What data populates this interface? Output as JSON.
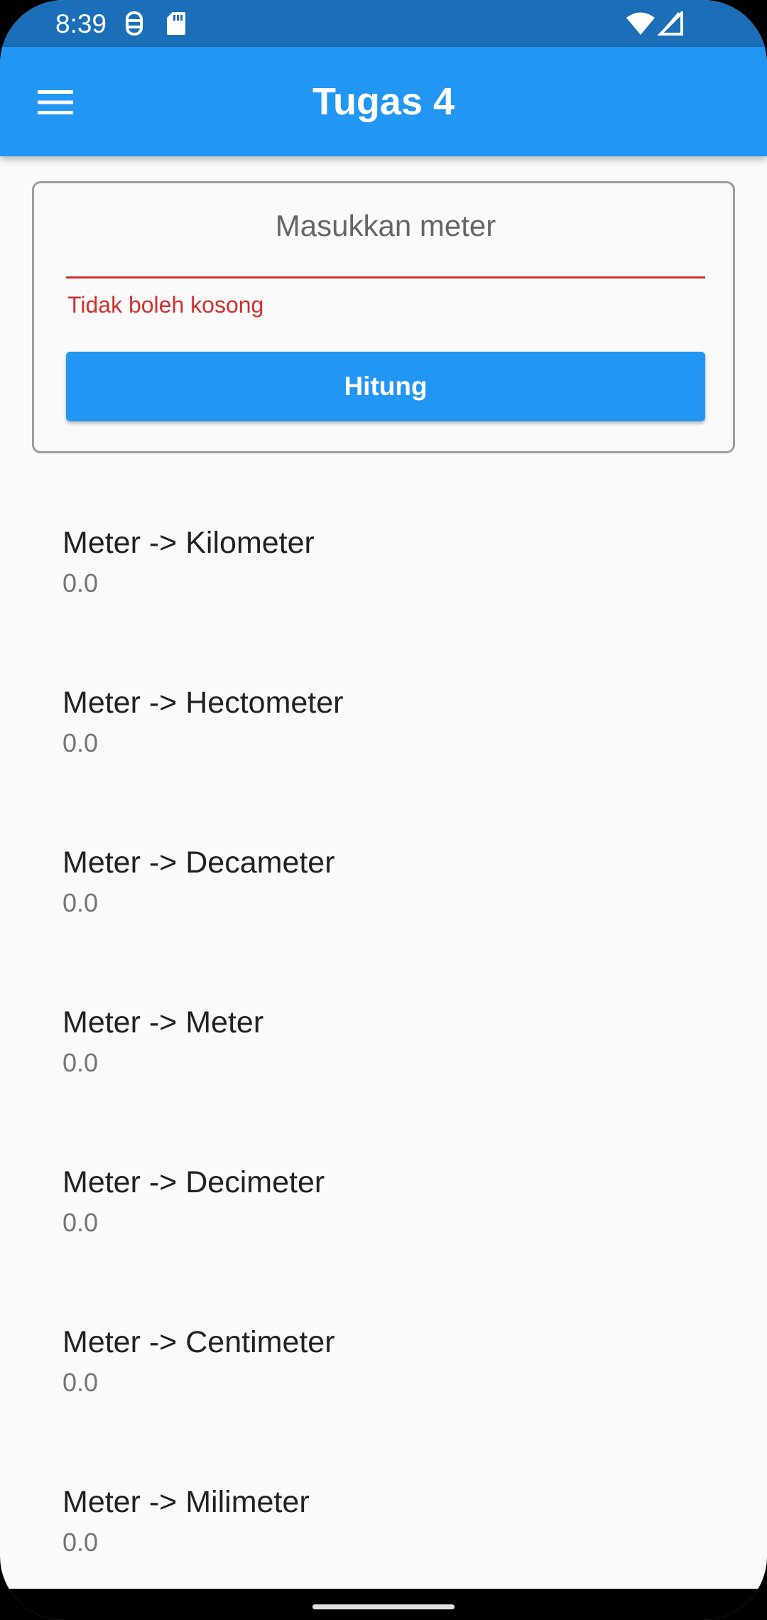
{
  "status_bar": {
    "time": "8:39"
  },
  "app_bar": {
    "title": "Tugas 4"
  },
  "form": {
    "input_placeholder": "Masukkan meter",
    "input_value": "",
    "error_text": "Tidak boleh kosong",
    "button_label": "Hitung"
  },
  "results": [
    {
      "label": "Meter -> Kilometer",
      "value": "0.0"
    },
    {
      "label": "Meter -> Hectometer",
      "value": "0.0"
    },
    {
      "label": "Meter -> Decameter",
      "value": "0.0"
    },
    {
      "label": "Meter -> Meter",
      "value": "0.0"
    },
    {
      "label": "Meter -> Decimeter",
      "value": "0.0"
    },
    {
      "label": "Meter -> Centimeter",
      "value": "0.0"
    },
    {
      "label": "Meter -> Milimeter",
      "value": "0.0"
    }
  ],
  "colors": {
    "primary": "#2196f3",
    "status_bar": "#1a6fb8",
    "error": "#d32f2f"
  }
}
